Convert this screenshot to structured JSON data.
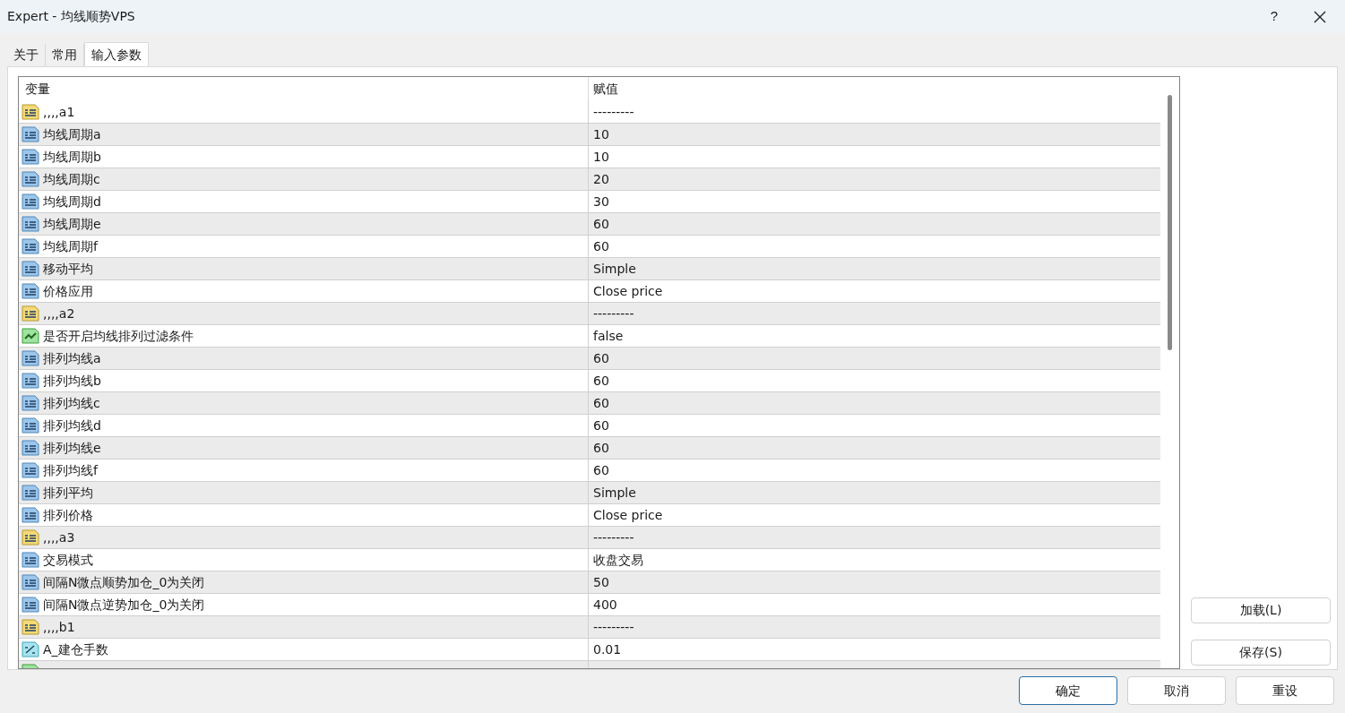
{
  "window": {
    "title": "Expert - 均线顺势VPS",
    "help": "?"
  },
  "tabs": [
    {
      "label": "关于",
      "selected": false
    },
    {
      "label": "常用",
      "selected": false
    },
    {
      "label": "输入参数",
      "selected": true
    }
  ],
  "table": {
    "columns": [
      "变量",
      "赋值"
    ],
    "rows": [
      {
        "kind": "string",
        "name": ",,,,a1",
        "value": "---------"
      },
      {
        "kind": "int",
        "name": "均线周期a",
        "value": "10"
      },
      {
        "kind": "int",
        "name": "均线周期b",
        "value": "10"
      },
      {
        "kind": "int",
        "name": "均线周期c",
        "value": "20"
      },
      {
        "kind": "int",
        "name": "均线周期d",
        "value": "30"
      },
      {
        "kind": "int",
        "name": "均线周期e",
        "value": "60"
      },
      {
        "kind": "int",
        "name": "均线周期f",
        "value": "60"
      },
      {
        "kind": "int",
        "name": "移动平均",
        "value": "Simple"
      },
      {
        "kind": "int",
        "name": "价格应用",
        "value": "Close price"
      },
      {
        "kind": "string",
        "name": ",,,,a2",
        "value": "---------"
      },
      {
        "kind": "bool",
        "name": "是否开启均线排列过滤条件",
        "value": "false"
      },
      {
        "kind": "int",
        "name": "排列均线a",
        "value": "60"
      },
      {
        "kind": "int",
        "name": "排列均线b",
        "value": "60"
      },
      {
        "kind": "int",
        "name": "排列均线c",
        "value": "60"
      },
      {
        "kind": "int",
        "name": "排列均线d",
        "value": "60"
      },
      {
        "kind": "int",
        "name": "排列均线e",
        "value": "60"
      },
      {
        "kind": "int",
        "name": "排列均线f",
        "value": "60"
      },
      {
        "kind": "int",
        "name": "排列平均",
        "value": "Simple"
      },
      {
        "kind": "int",
        "name": "排列价格",
        "value": "Close price"
      },
      {
        "kind": "string",
        "name": ",,,,a3",
        "value": "---------"
      },
      {
        "kind": "int",
        "name": "交易模式",
        "value": "收盘交易"
      },
      {
        "kind": "int",
        "name": "间隔N微点顺势加仓_0为关闭",
        "value": "50"
      },
      {
        "kind": "int",
        "name": "间隔N微点逆势加仓_0为关闭",
        "value": "400"
      },
      {
        "kind": "string",
        "name": ",,,,b1",
        "value": "---------"
      },
      {
        "kind": "double",
        "name": "A_建仓手数",
        "value": "0.01"
      },
      {
        "kind": "bool"
      }
    ]
  },
  "side_buttons": [
    "加载(L)",
    "保存(S)"
  ],
  "buttons": [
    {
      "label": "确定",
      "selected": true
    },
    {
      "label": "取消",
      "selected": false
    },
    {
      "label": "重设",
      "selected": false
    }
  ]
}
